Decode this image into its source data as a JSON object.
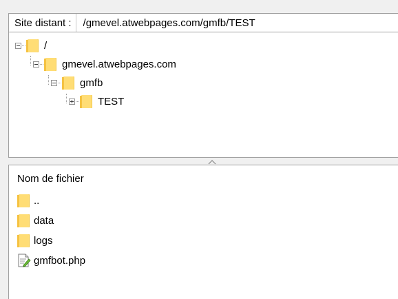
{
  "remote_site": {
    "label": "Site distant :",
    "path": "/gmevel.atwebpages.com/gmfb/TEST"
  },
  "tree": {
    "nodes": [
      {
        "label": "/",
        "expander": "minus",
        "icon": "folder-icon"
      },
      {
        "label": "gmevel.atwebpages.com",
        "expander": "minus",
        "icon": "folder-icon"
      },
      {
        "label": "gmfb",
        "expander": "minus",
        "icon": "folder-icon"
      },
      {
        "label": "TEST",
        "expander": "plus",
        "icon": "folder-icon"
      }
    ]
  },
  "file_list": {
    "column_header": "Nom de fichier",
    "rows": [
      {
        "name": "..",
        "icon": "folder-icon"
      },
      {
        "name": "data",
        "icon": "folder-icon"
      },
      {
        "name": "logs",
        "icon": "folder-icon"
      },
      {
        "name": "gmfbot.php",
        "icon": "php-file-icon"
      }
    ]
  },
  "colors": {
    "folder": "#ffdd75",
    "folder_edge": "#f5c242",
    "border": "#a0a0a0",
    "panel_bg": "#ffffff",
    "window_bg": "#f0f0f0"
  }
}
